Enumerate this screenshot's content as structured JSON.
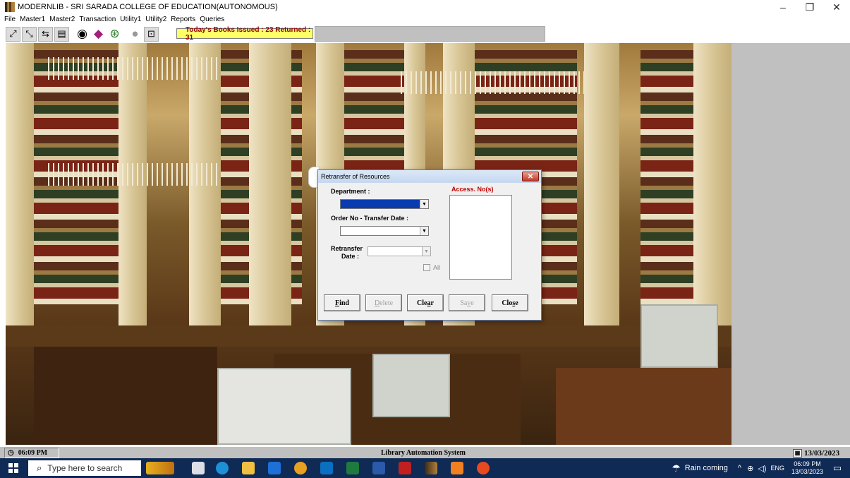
{
  "window": {
    "title": "MODERNLIB - SRI SARADA COLLEGE OF EDUCATION(AUTONOMOUS)",
    "minimize": "–",
    "restore": "❐",
    "close": "✕"
  },
  "menu": [
    "File",
    "Master1",
    "Master2",
    "Transaction",
    "Utility1",
    "Utility2",
    "Reports",
    "Queries"
  ],
  "toolbar": {
    "status_text": "Today's Books Issued : 23 Returned : 31",
    "icons": [
      "issue-icon",
      "return-icon",
      "transfer-icon",
      "catalog-icon",
      "view-icon",
      "book-icon",
      "disc-icon",
      "chat-icon",
      "exit-icon"
    ]
  },
  "dialog": {
    "title": "Retransfer of Resources",
    "close_symbol": "✕",
    "department_label": "Department :",
    "order_label": "Order No - Transfer Date :",
    "retransfer_label_1": "Retransfer",
    "retransfer_label_2": "Date :",
    "all_label": "All",
    "access_label": "Access. No(s)",
    "buttons": {
      "find": "Find",
      "delete": "Delete",
      "clear": "Clear",
      "save": "Save",
      "close": "Close"
    }
  },
  "statusbar": {
    "time": "06:09 PM",
    "title": "Library Automation System",
    "date": "13/03/2023"
  },
  "taskbar": {
    "search_placeholder": "Type here to search",
    "weather": "Rain coming",
    "lang": "ENG",
    "clock_time": "06:09 PM",
    "clock_date": "13/03/2023"
  },
  "colors": {
    "status_bg": "#ffff66",
    "status_fg": "#8b0000",
    "access_label": "#c00000",
    "taskbar": "#0f2a55"
  }
}
